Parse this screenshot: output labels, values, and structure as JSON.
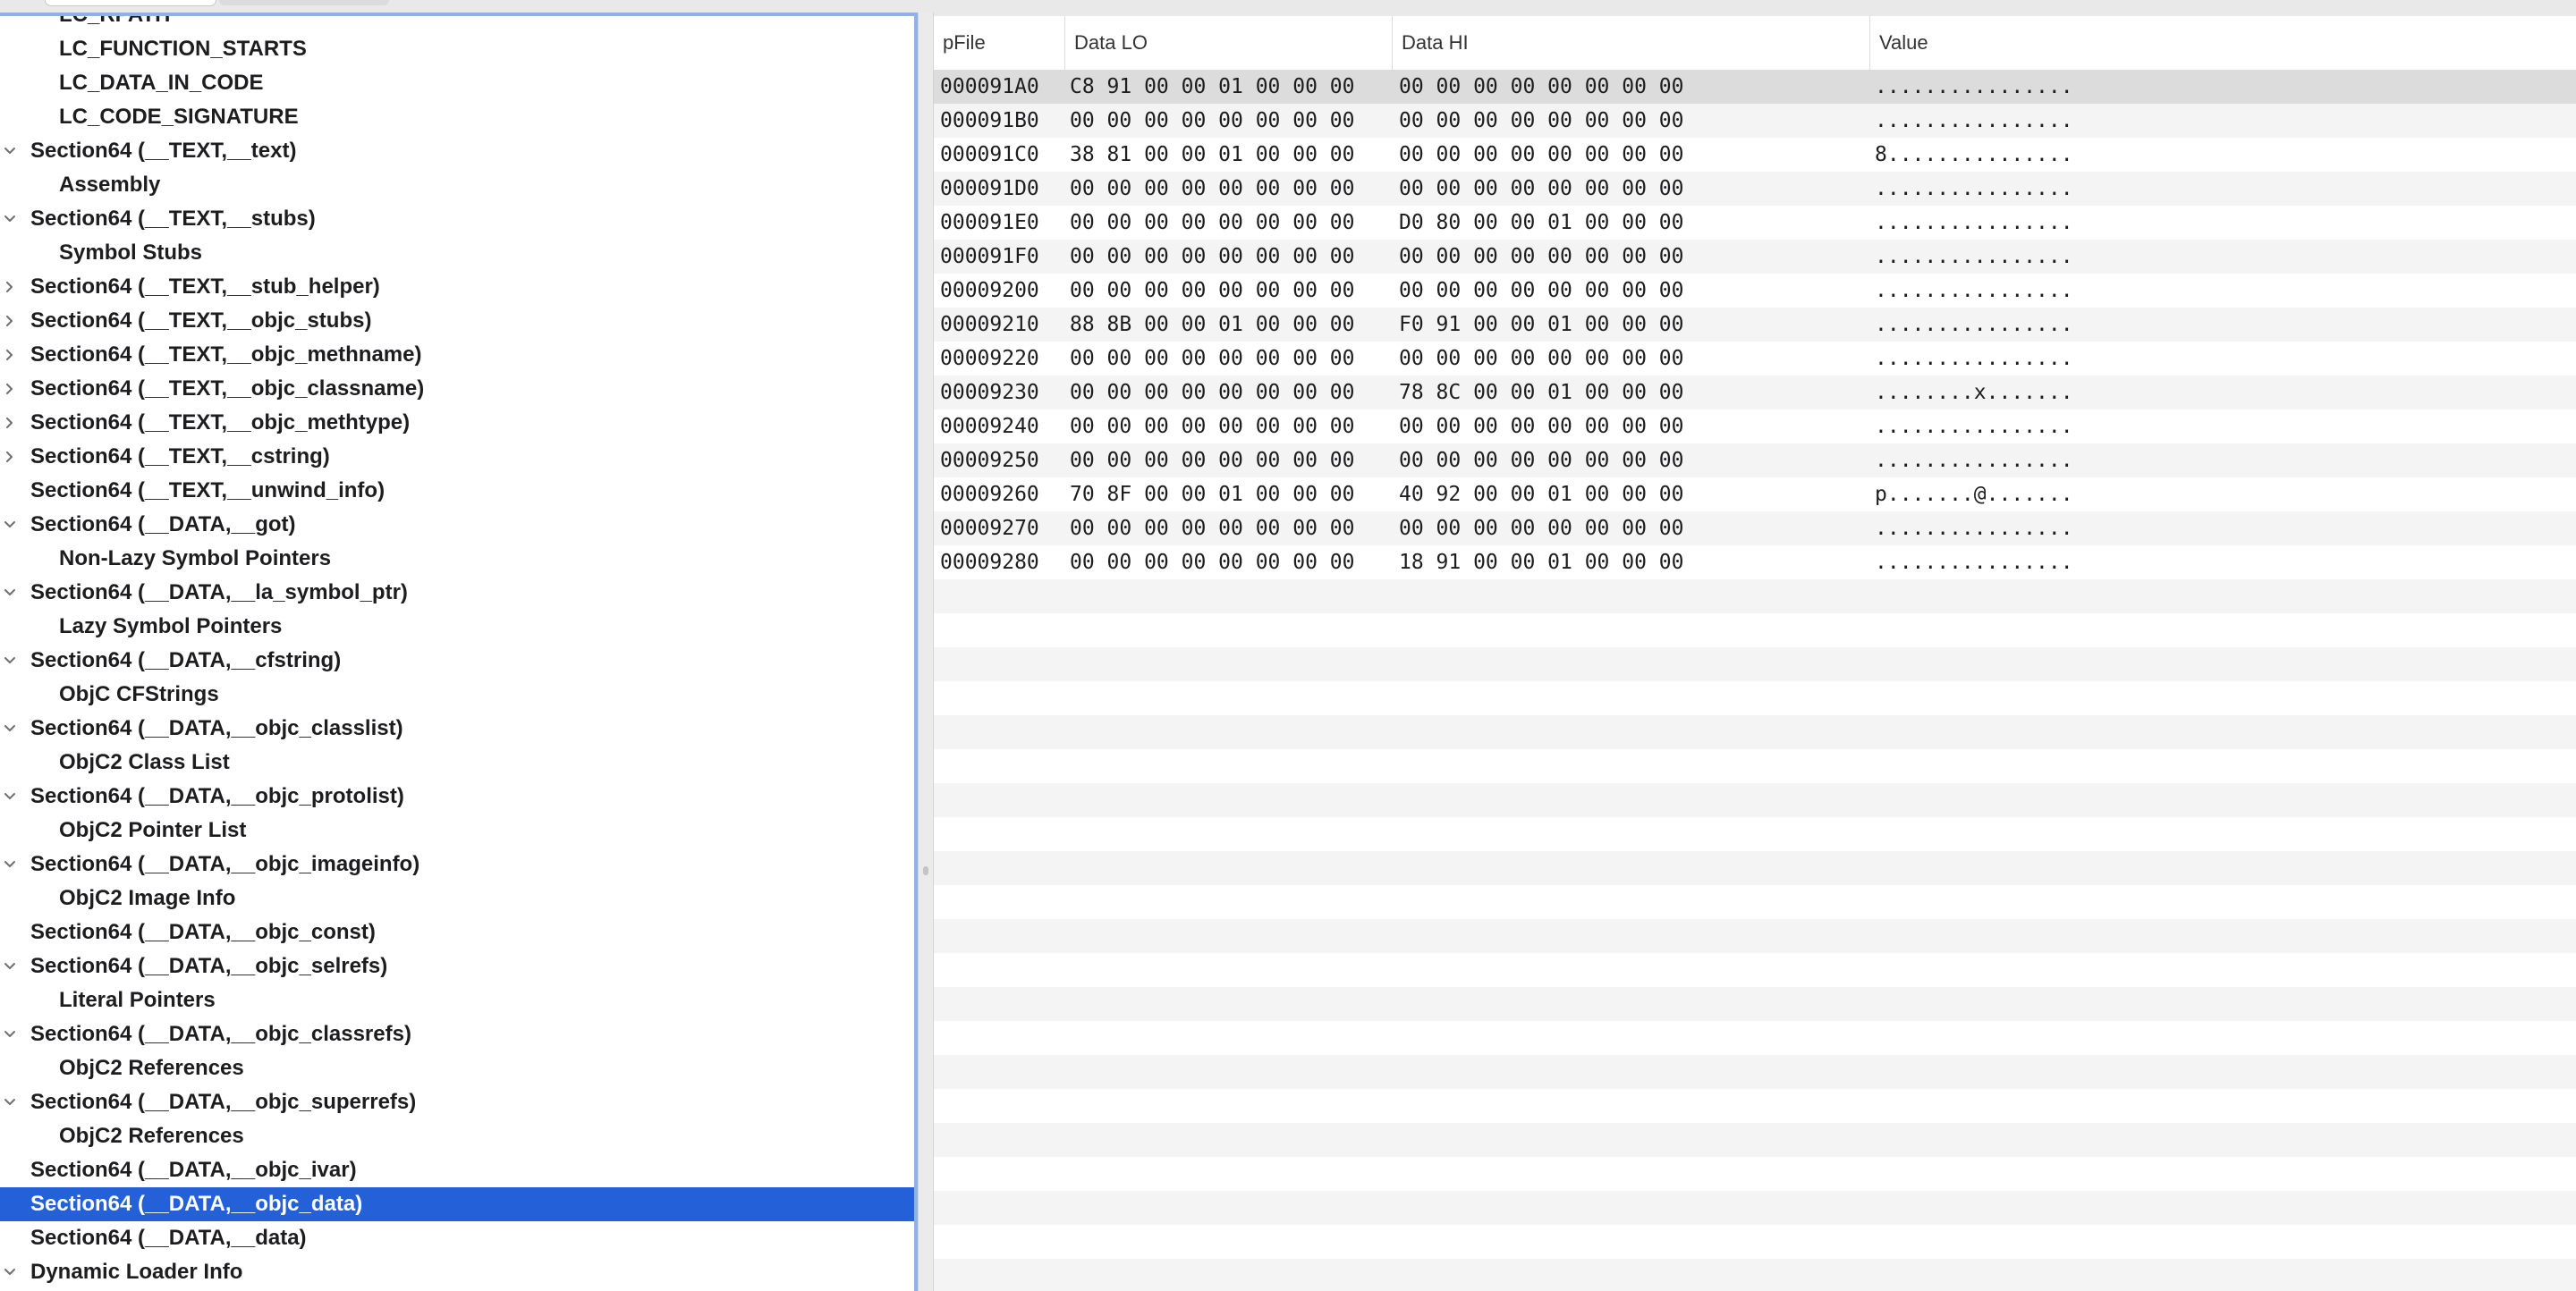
{
  "tree": {
    "rows": [
      {
        "label": "LC_RPATH",
        "indent": 1,
        "chevron": "none",
        "selected": false
      },
      {
        "label": "LC_FUNCTION_STARTS",
        "indent": 1,
        "chevron": "none",
        "selected": false
      },
      {
        "label": "LC_DATA_IN_CODE",
        "indent": 1,
        "chevron": "none",
        "selected": false
      },
      {
        "label": "LC_CODE_SIGNATURE",
        "indent": 1,
        "chevron": "none",
        "selected": false
      },
      {
        "label": "Section64 (__TEXT,__text)",
        "indent": 0,
        "chevron": "down",
        "selected": false
      },
      {
        "label": "Assembly",
        "indent": 1,
        "chevron": "none",
        "selected": false
      },
      {
        "label": "Section64 (__TEXT,__stubs)",
        "indent": 0,
        "chevron": "down",
        "selected": false
      },
      {
        "label": "Symbol Stubs",
        "indent": 1,
        "chevron": "none",
        "selected": false
      },
      {
        "label": "Section64 (__TEXT,__stub_helper)",
        "indent": 0,
        "chevron": "right",
        "selected": false
      },
      {
        "label": "Section64 (__TEXT,__objc_stubs)",
        "indent": 0,
        "chevron": "right",
        "selected": false
      },
      {
        "label": "Section64 (__TEXT,__objc_methname)",
        "indent": 0,
        "chevron": "right",
        "selected": false
      },
      {
        "label": "Section64 (__TEXT,__objc_classname)",
        "indent": 0,
        "chevron": "right",
        "selected": false
      },
      {
        "label": "Section64 (__TEXT,__objc_methtype)",
        "indent": 0,
        "chevron": "right",
        "selected": false
      },
      {
        "label": "Section64 (__TEXT,__cstring)",
        "indent": 0,
        "chevron": "right",
        "selected": false
      },
      {
        "label": "Section64 (__TEXT,__unwind_info)",
        "indent": 0,
        "chevron": "none",
        "selected": false
      },
      {
        "label": "Section64 (__DATA,__got)",
        "indent": 0,
        "chevron": "down",
        "selected": false
      },
      {
        "label": "Non-Lazy Symbol Pointers",
        "indent": 1,
        "chevron": "none",
        "selected": false
      },
      {
        "label": "Section64 (__DATA,__la_symbol_ptr)",
        "indent": 0,
        "chevron": "down",
        "selected": false
      },
      {
        "label": "Lazy Symbol Pointers",
        "indent": 1,
        "chevron": "none",
        "selected": false
      },
      {
        "label": "Section64 (__DATA,__cfstring)",
        "indent": 0,
        "chevron": "down",
        "selected": false
      },
      {
        "label": "ObjC CFStrings",
        "indent": 1,
        "chevron": "none",
        "selected": false
      },
      {
        "label": "Section64 (__DATA,__objc_classlist)",
        "indent": 0,
        "chevron": "down",
        "selected": false
      },
      {
        "label": "ObjC2 Class List",
        "indent": 1,
        "chevron": "none",
        "selected": false
      },
      {
        "label": "Section64 (__DATA,__objc_protolist)",
        "indent": 0,
        "chevron": "down",
        "selected": false
      },
      {
        "label": "ObjC2 Pointer List",
        "indent": 1,
        "chevron": "none",
        "selected": false
      },
      {
        "label": "Section64 (__DATA,__objc_imageinfo)",
        "indent": 0,
        "chevron": "down",
        "selected": false
      },
      {
        "label": "ObjC2 Image Info",
        "indent": 1,
        "chevron": "none",
        "selected": false
      },
      {
        "label": "Section64 (__DATA,__objc_const)",
        "indent": 0,
        "chevron": "none",
        "selected": false
      },
      {
        "label": "Section64 (__DATA,__objc_selrefs)",
        "indent": 0,
        "chevron": "down",
        "selected": false
      },
      {
        "label": "Literal Pointers",
        "indent": 1,
        "chevron": "none",
        "selected": false
      },
      {
        "label": "Section64 (__DATA,__objc_classrefs)",
        "indent": 0,
        "chevron": "down",
        "selected": false
      },
      {
        "label": "ObjC2 References",
        "indent": 1,
        "chevron": "none",
        "selected": false
      },
      {
        "label": "Section64 (__DATA,__objc_superrefs)",
        "indent": 0,
        "chevron": "down",
        "selected": false
      },
      {
        "label": "ObjC2 References",
        "indent": 1,
        "chevron": "none",
        "selected": false
      },
      {
        "label": "Section64 (__DATA,__objc_ivar)",
        "indent": 0,
        "chevron": "none",
        "selected": false
      },
      {
        "label": "Section64 (__DATA,__objc_data)",
        "indent": 0,
        "chevron": "none",
        "selected": true
      },
      {
        "label": "Section64 (__DATA,__data)",
        "indent": 0,
        "chevron": "none",
        "selected": false
      },
      {
        "label": "Dynamic Loader Info",
        "indent": 0,
        "chevron": "down",
        "selected": false
      }
    ]
  },
  "table": {
    "headers": {
      "pfile": "pFile",
      "data_lo": "Data LO",
      "data_hi": "Data HI",
      "value": "Value"
    },
    "rows": [
      {
        "pfile": "000091A0",
        "lo": "C8 91 00 00 01 00 00 00",
        "hi": "00 00 00 00 00 00 00 00",
        "value": "................",
        "selected": true
      },
      {
        "pfile": "000091B0",
        "lo": "00 00 00 00 00 00 00 00",
        "hi": "00 00 00 00 00 00 00 00",
        "value": "................"
      },
      {
        "pfile": "000091C0",
        "lo": "38 81 00 00 01 00 00 00",
        "hi": "00 00 00 00 00 00 00 00",
        "value": "8..............."
      },
      {
        "pfile": "000091D0",
        "lo": "00 00 00 00 00 00 00 00",
        "hi": "00 00 00 00 00 00 00 00",
        "value": "................"
      },
      {
        "pfile": "000091E0",
        "lo": "00 00 00 00 00 00 00 00",
        "hi": "D0 80 00 00 01 00 00 00",
        "value": "................"
      },
      {
        "pfile": "000091F0",
        "lo": "00 00 00 00 00 00 00 00",
        "hi": "00 00 00 00 00 00 00 00",
        "value": "................"
      },
      {
        "pfile": "00009200",
        "lo": "00 00 00 00 00 00 00 00",
        "hi": "00 00 00 00 00 00 00 00",
        "value": "................"
      },
      {
        "pfile": "00009210",
        "lo": "88 8B 00 00 01 00 00 00",
        "hi": "F0 91 00 00 01 00 00 00",
        "value": "................"
      },
      {
        "pfile": "00009220",
        "lo": "00 00 00 00 00 00 00 00",
        "hi": "00 00 00 00 00 00 00 00",
        "value": "................"
      },
      {
        "pfile": "00009230",
        "lo": "00 00 00 00 00 00 00 00",
        "hi": "78 8C 00 00 01 00 00 00",
        "value": "........x......."
      },
      {
        "pfile": "00009240",
        "lo": "00 00 00 00 00 00 00 00",
        "hi": "00 00 00 00 00 00 00 00",
        "value": "................"
      },
      {
        "pfile": "00009250",
        "lo": "00 00 00 00 00 00 00 00",
        "hi": "00 00 00 00 00 00 00 00",
        "value": "................"
      },
      {
        "pfile": "00009260",
        "lo": "70 8F 00 00 01 00 00 00",
        "hi": "40 92 00 00 01 00 00 00",
        "value": "p.......@......."
      },
      {
        "pfile": "00009270",
        "lo": "00 00 00 00 00 00 00 00",
        "hi": "00 00 00 00 00 00 00 00",
        "value": "................"
      },
      {
        "pfile": "00009280",
        "lo": "00 00 00 00 00 00 00 00",
        "hi": "18 91 00 00 01 00 00 00",
        "value": "................"
      }
    ]
  },
  "colors": {
    "selection": "#2461d9",
    "focus_ring": "#8fb0ea",
    "stripe": "#f4f4f4",
    "row_selected": "#dcdcdc"
  }
}
